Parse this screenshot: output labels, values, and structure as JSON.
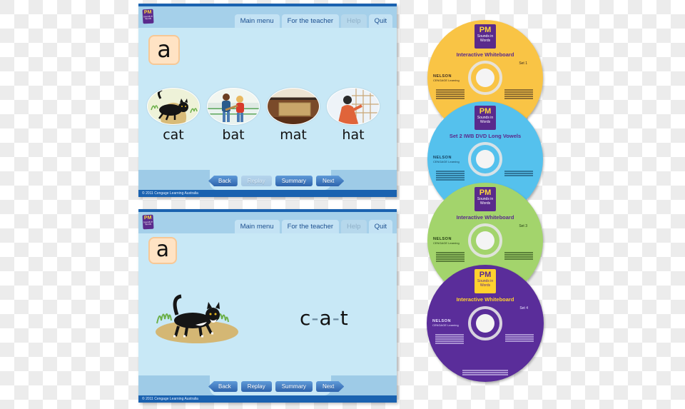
{
  "screens": [
    {
      "tabs": [
        {
          "label": "Main menu",
          "enabled": true
        },
        {
          "label": "For the teacher",
          "enabled": true
        },
        {
          "label": "Help",
          "enabled": false
        },
        {
          "label": "Quit",
          "enabled": true
        }
      ],
      "logo": {
        "title": "PM",
        "subtitle": "Sounds in Words"
      },
      "letter": "a",
      "words": [
        {
          "label": "cat",
          "image": "cat-picture"
        },
        {
          "label": "bat",
          "image": "boys-with-bat-picture"
        },
        {
          "label": "mat",
          "image": "doormat-picture"
        },
        {
          "label": "hat",
          "image": "girl-with-hat-picture"
        }
      ],
      "nav": [
        {
          "label": "Back",
          "enabled": true
        },
        {
          "label": "Replay",
          "enabled": false
        },
        {
          "label": "Summary",
          "enabled": true
        },
        {
          "label": "Next",
          "enabled": true
        }
      ],
      "copyright": "© 2011 Cengage Learning Australia"
    },
    {
      "tabs": [
        {
          "label": "Main menu",
          "enabled": true
        },
        {
          "label": "For the teacher",
          "enabled": true
        },
        {
          "label": "Help",
          "enabled": false
        },
        {
          "label": "Quit",
          "enabled": true
        }
      ],
      "logo": {
        "title": "PM",
        "subtitle": "Sounds in Words"
      },
      "letter": "a",
      "blend": {
        "parts": [
          "c",
          "a",
          "t"
        ],
        "separator": "-"
      },
      "image": "cat-on-grass-picture",
      "nav": [
        {
          "label": "Back",
          "enabled": true
        },
        {
          "label": "Replay",
          "enabled": true
        },
        {
          "label": "Summary",
          "enabled": true
        },
        {
          "label": "Next",
          "enabled": true
        }
      ],
      "copyright": "© 2011 Cengage Learning Australia"
    }
  ],
  "discs": [
    {
      "color": "#f9c445",
      "badge": "PM",
      "badge_sub": "Sounds in Words",
      "title": "Interactive Whiteboard",
      "set": "Set 1",
      "publisher": "NELSON",
      "publisher_sub": "CENGAGE Learning"
    },
    {
      "color": "#55c1ed",
      "badge": "PM",
      "badge_sub": "Sounds in Words",
      "title": "Set 2 IWB DVD Long Vowels",
      "set": "",
      "publisher": "NELSON",
      "publisher_sub": "CENGAGE Learning"
    },
    {
      "color": "#a3d46c",
      "badge": "PM",
      "badge_sub": "Sounds in Words",
      "title": "Interactive Whiteboard",
      "set": "Set 3",
      "publisher": "NELSON",
      "publisher_sub": "CENGAGE Learning"
    },
    {
      "color": "#5a2d9a",
      "badge": "PM",
      "badge_sub": "Sounds in Words",
      "title": "Interactive Whiteboard",
      "set": "Set 4",
      "publisher": "NELSON",
      "publisher_sub": "CENGAGE Learning"
    }
  ],
  "colors": {
    "panel_bg": "#c8e8f6",
    "header_bg": "#a5d0ea",
    "brand_blue": "#1a62b0",
    "tab_text": "#1c4f8f",
    "letter_card": "#ffe3c4",
    "logo_purple": "#5a2a8c"
  }
}
